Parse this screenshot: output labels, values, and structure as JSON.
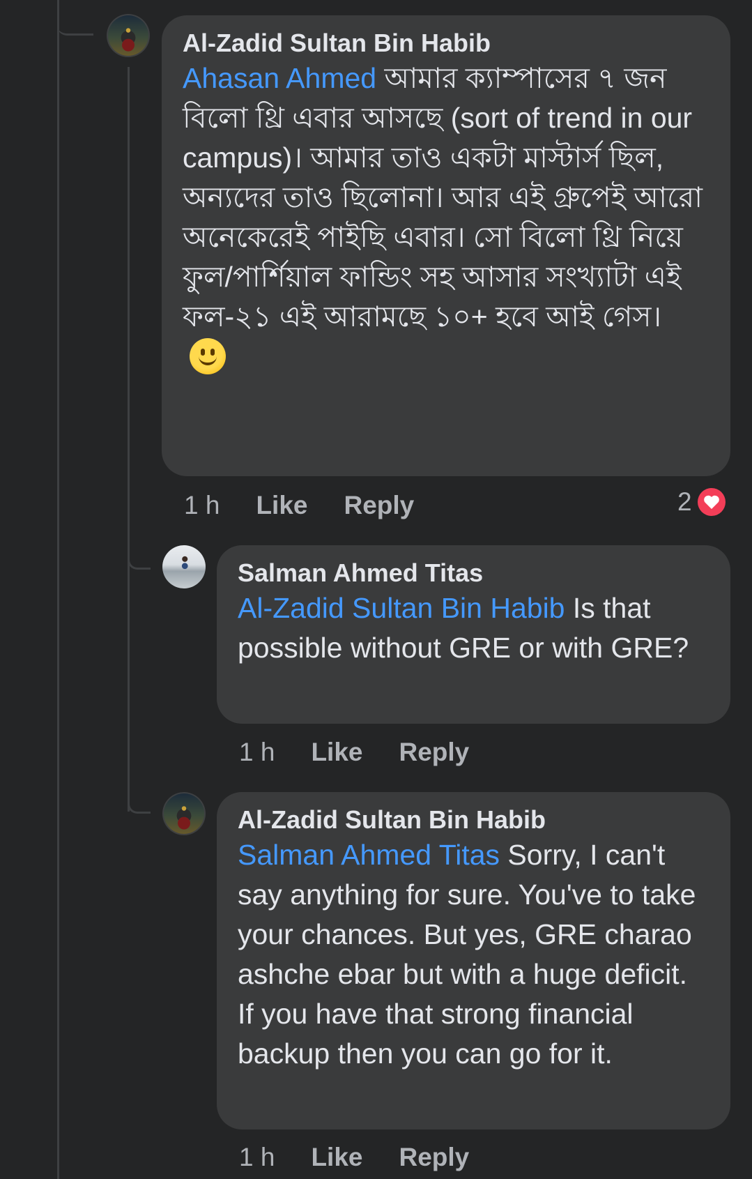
{
  "comments": [
    {
      "author": "Al-Zadid Sultan Bin Habib",
      "mention": "Ahasan Ahmed",
      "text": " আমার ক্যাম্পাসের ৭ জন বিলো থ্রি এবার আসছে (sort of trend in our campus)। আমার তাও একটা মাস্টার্স ছিল, অন্যদের তাও ছিলোনা। আর এই গ্রুপেই আরো অনেকেরেই পাইছি এবার। সো বিলো থ্রি নিয়ে ফুল/পার্শিয়াল ফান্ডিং সহ আসার সংখ্যাটা এই ফল-২১ এই আরামছে ১০+ হবে আই গেস। ",
      "time": "1 h",
      "like": "Like",
      "reply": "Reply",
      "reaction_count": "2",
      "reaction_icon": "heart-icon",
      "emoji": "slightly-smiling-face-emoji"
    },
    {
      "author": "Salman Ahmed Titas",
      "mention": "Al-Zadid Sultan Bin Habib",
      "text": " Is that possible without GRE or with GRE?",
      "time": "1 h",
      "like": "Like",
      "reply": "Reply"
    },
    {
      "author": "Al-Zadid Sultan Bin Habib",
      "mention": "Salman Ahmed Titas",
      "text": " Sorry, I can't say anything for sure. You've to take your chances. But yes, GRE charao ashche ebar but with a huge deficit.  If you have that strong financial backup then you can go for it.",
      "time": "1 h",
      "like": "Like",
      "reply": "Reply"
    }
  ],
  "colors": {
    "background": "#242526",
    "bubble": "#3a3b3c",
    "mention": "#4599ff",
    "meta_text": "#b0b3b8",
    "reaction": "#f33e58"
  }
}
